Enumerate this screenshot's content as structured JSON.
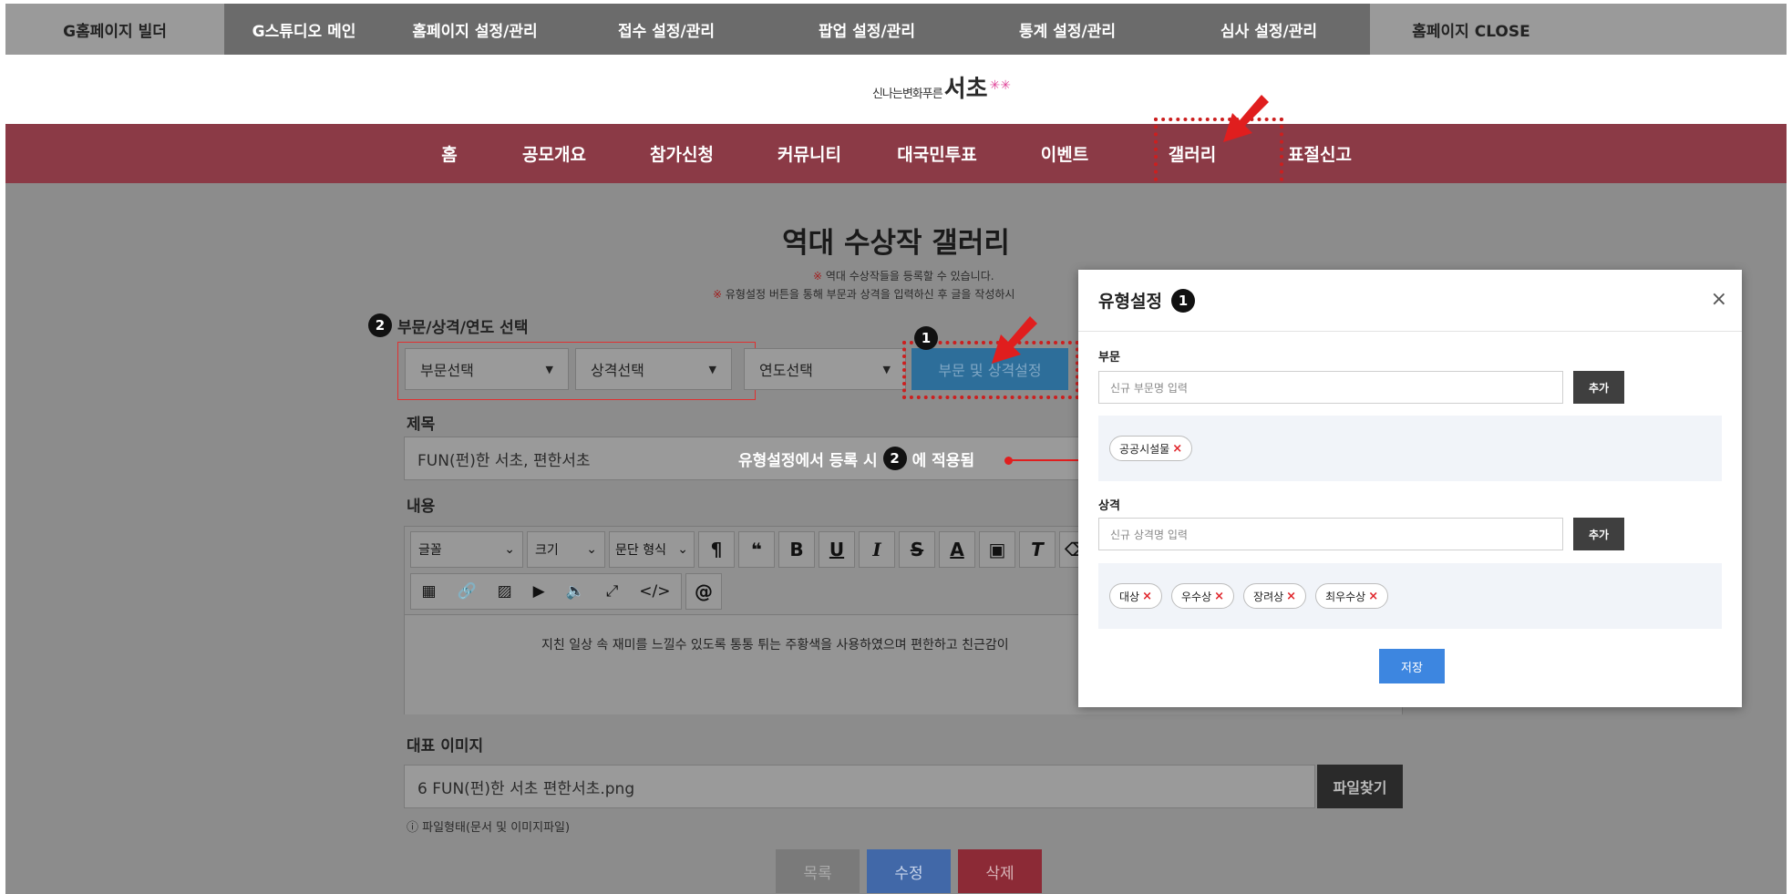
{
  "topbar": {
    "items": [
      {
        "label": "G홈페이지 빌더"
      },
      {
        "label": "G스튜디오 메인"
      },
      {
        "label": "홈페이지 설정/관리"
      },
      {
        "label": "접수 설정/관리"
      },
      {
        "label": "팝업 설정/관리"
      },
      {
        "label": "통계 설정/관리"
      },
      {
        "label": "심사 설정/관리"
      },
      {
        "label": "홈페이지 CLOSE"
      }
    ]
  },
  "logo": {
    "small": "신나는변화푸른",
    "big": "서초"
  },
  "mainnav": {
    "items": [
      {
        "label": "홈"
      },
      {
        "label": "공모개요"
      },
      {
        "label": "참가신청"
      },
      {
        "label": "커뮤니티"
      },
      {
        "label": "대국민투표"
      },
      {
        "label": "이벤트"
      },
      {
        "label": "갤러리"
      },
      {
        "label": "표절신고"
      }
    ]
  },
  "page": {
    "title": "역대 수상작 갤러리",
    "note1_mark": "※",
    "note1": " 역대 수상작들을 등록할 수 있습니다.",
    "note2_mark": "※",
    "note2": " 유형설정 버튼을 통해 부문과 상격을 입력하신 후 글을 작성하시",
    "select_label": "부문/상격/연도 선택",
    "select_label_num": "2",
    "select_division": "부문선택",
    "select_award": "상격선택",
    "select_year": "연도선택",
    "type_button": "부문 및 상격설정",
    "type_button_num": "1",
    "title_label": "제목",
    "title_value": "FUN(펀)한 서초, 편한서초",
    "content_label": "내용",
    "editor": {
      "font": "글꼴",
      "size": "크기",
      "paragraph": "문단 형식",
      "body": "지친 일상 속 재미를 느낄수 있도록 통통 튀는 주황색을 사용하였으며 편한하고 친근감이"
    },
    "image_label": "대표 이미지",
    "image_value": "6 FUN(펀)한 서초 편한서초.png",
    "file_button": "파일찾기",
    "file_hint": "ⓘ 파일형태(문서 및 이미지파일)",
    "btn_list": "목록",
    "btn_edit": "수정",
    "btn_delete": "삭제"
  },
  "annotation": {
    "text_before": "유형설정에서 등록 시",
    "num": "2",
    "text_after": "에 적용됨"
  },
  "modal": {
    "title": "유형설정",
    "title_num": "1",
    "close": "×",
    "division_label": "부문",
    "division_placeholder": "신규 부문명 입력",
    "add": "추가",
    "division_tags": [
      {
        "label": "공공시설물"
      }
    ],
    "award_label": "상격",
    "award_placeholder": "신규 상격명 입력",
    "award_tags": [
      {
        "label": "대상"
      },
      {
        "label": "우수상"
      },
      {
        "label": "장려상"
      },
      {
        "label": "최우수상"
      }
    ],
    "tag_delete": "×",
    "save": "저장"
  },
  "colors": {
    "nav_bg": "#8b3a46",
    "topbar_bg": "#6b6b6b",
    "highlight": "#cc1f1f",
    "save_blue": "#3d86e0"
  }
}
